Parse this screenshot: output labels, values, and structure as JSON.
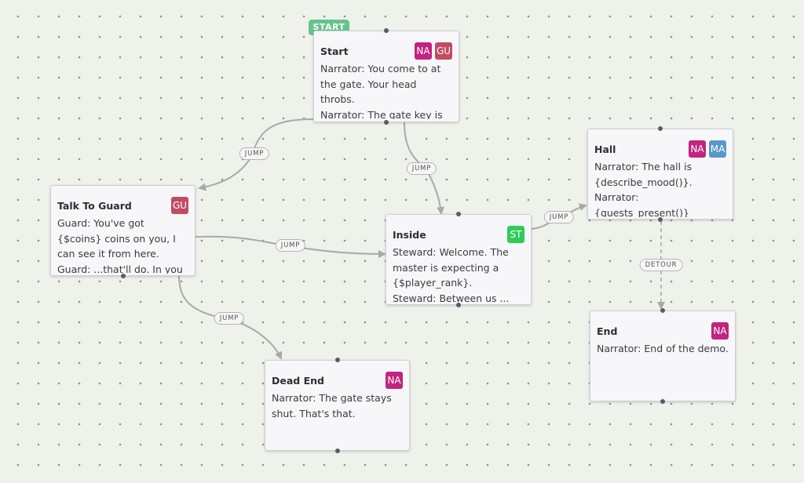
{
  "start_tag": "START",
  "colors": {
    "NA": "#c2247f",
    "GU": "#c24b63",
    "MA": "#5a97c8",
    "ST": "#2fcc5a",
    "start": "#63c48c",
    "edge": "#a9a9a9"
  },
  "nodes": {
    "start": {
      "title": "Start",
      "badges": [
        "NA",
        "GU"
      ],
      "lines": [
        "Narrator: You come to at the gate. Your head throbs.",
        "Narrator: The gate key is still in your pocket. Small mercies."
      ]
    },
    "talk_to_guard": {
      "title": "Talk To Guard",
      "badges": [
        "GU"
      ],
      "lines": [
        "Guard: You've got {$coins} coins on you, I can see it from here.",
        "Guard: ...that'll do. In you go."
      ]
    },
    "inside": {
      "title": "Inside",
      "badges": [
        "ST"
      ],
      "lines": [
        "Steward: Welcome. The master is expecting a {$player_rank}.",
        "Steward: Between us ... that"
      ]
    },
    "hall": {
      "title": "Hall",
      "badges": [
        "NA",
        "MA"
      ],
      "lines": [
        "Narrator: The hall is {describe_mood()}.",
        "Narrator: {guests_present()} guests, at least. A proper"
      ]
    },
    "dead_end": {
      "title": "Dead End",
      "badges": [
        "NA"
      ],
      "lines": [
        "Narrator: The gate stays shut. That's that."
      ]
    },
    "end": {
      "title": "End",
      "badges": [
        "NA"
      ],
      "lines": [
        "Narrator: End of the demo."
      ]
    }
  },
  "edges": [
    {
      "label": "JUMP"
    },
    {
      "label": "JUMP"
    },
    {
      "label": "JUMP"
    },
    {
      "label": "JUMP"
    },
    {
      "label": "JUMP"
    },
    {
      "label": "DETOUR"
    }
  ]
}
